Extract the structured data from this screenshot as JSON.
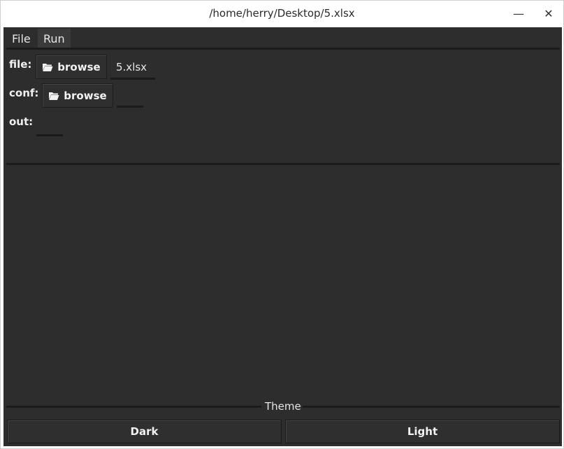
{
  "window": {
    "title": "/home/herry/Desktop/5.xlsx",
    "minimize_glyph": "—",
    "close_glyph": "✕"
  },
  "menu": {
    "items": [
      {
        "label": "File"
      },
      {
        "label": "Run"
      }
    ]
  },
  "form": {
    "file_label": "file:",
    "conf_label": "conf:",
    "out_label": "out:",
    "browse_label": "browse",
    "file_value": "5.xlsx",
    "conf_value": "",
    "out_value": ""
  },
  "theme": {
    "group_label": "Theme",
    "dark_label": "Dark",
    "light_label": "Light"
  },
  "icons": {
    "folder": "folder-open-icon",
    "minimize": "minimize-icon",
    "close": "close-icon"
  },
  "colors": {
    "background": "#2d2d2d",
    "text": "#f0f0f0",
    "separator": "#1b1b1b"
  }
}
